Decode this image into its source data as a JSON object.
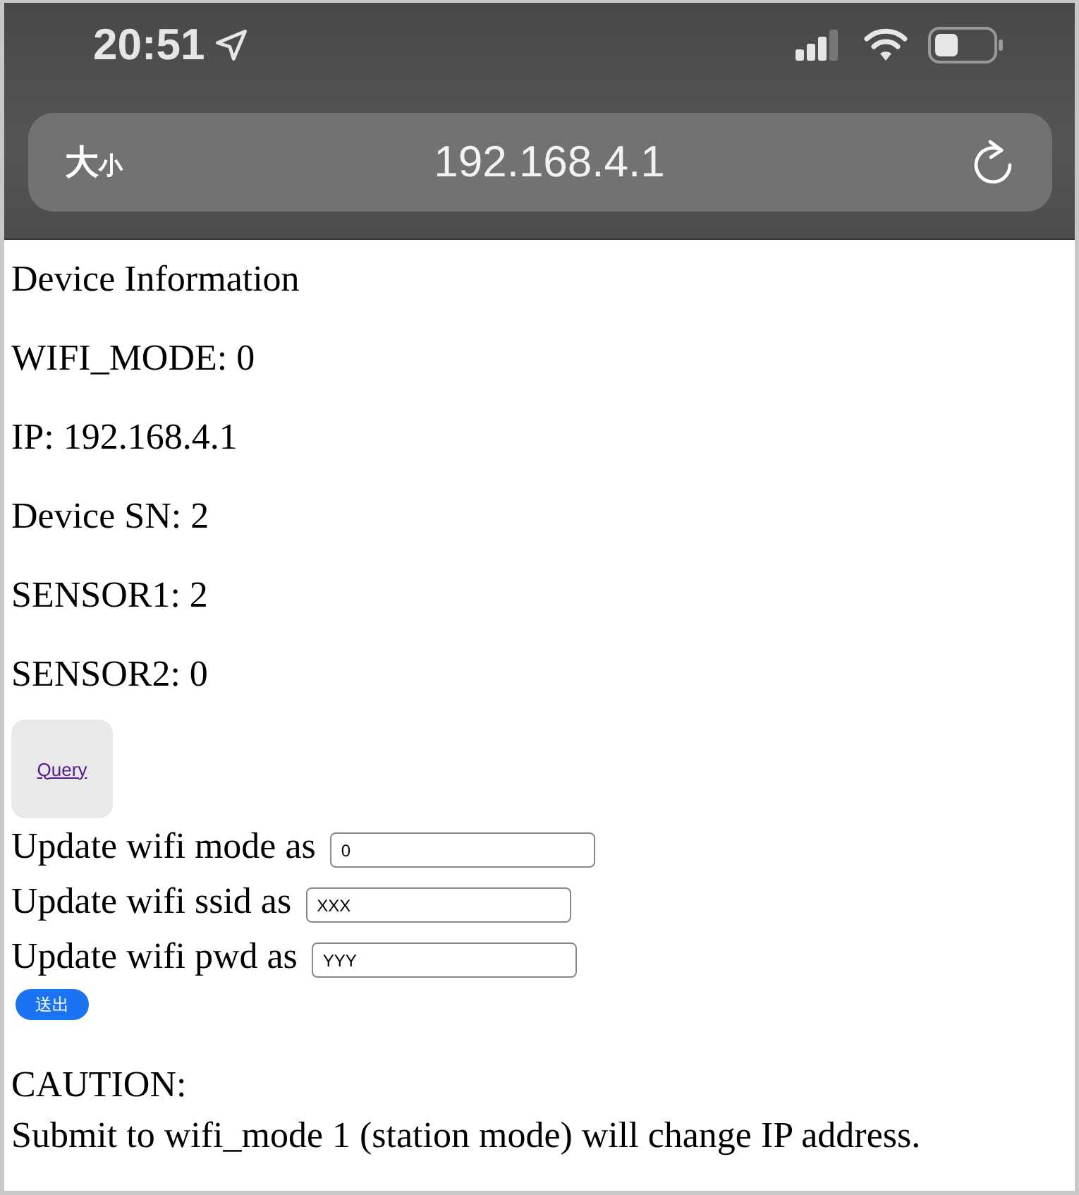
{
  "status_bar": {
    "time": "20:51"
  },
  "address_bar": {
    "text_size_button": [
      "大",
      "小"
    ],
    "url": "192.168.4.1"
  },
  "info": {
    "title": "Device Information",
    "lines": [
      "WIFI_MODE: 0",
      "IP: 192.168.4.1",
      "Device SN: 2",
      "SENSOR1: 2",
      "SENSOR2: 0"
    ]
  },
  "query_link": "Query",
  "form": {
    "fields": [
      {
        "label": "Update wifi mode as",
        "value": "0"
      },
      {
        "label": "Update wifi ssid as",
        "value": "XXX"
      },
      {
        "label": "Update wifi pwd as",
        "value": "YYY"
      }
    ],
    "submit": "送出"
  },
  "caution": {
    "title": "CAUTION:",
    "text": "Submit to wifi_mode 1 (station mode) will change IP address."
  }
}
